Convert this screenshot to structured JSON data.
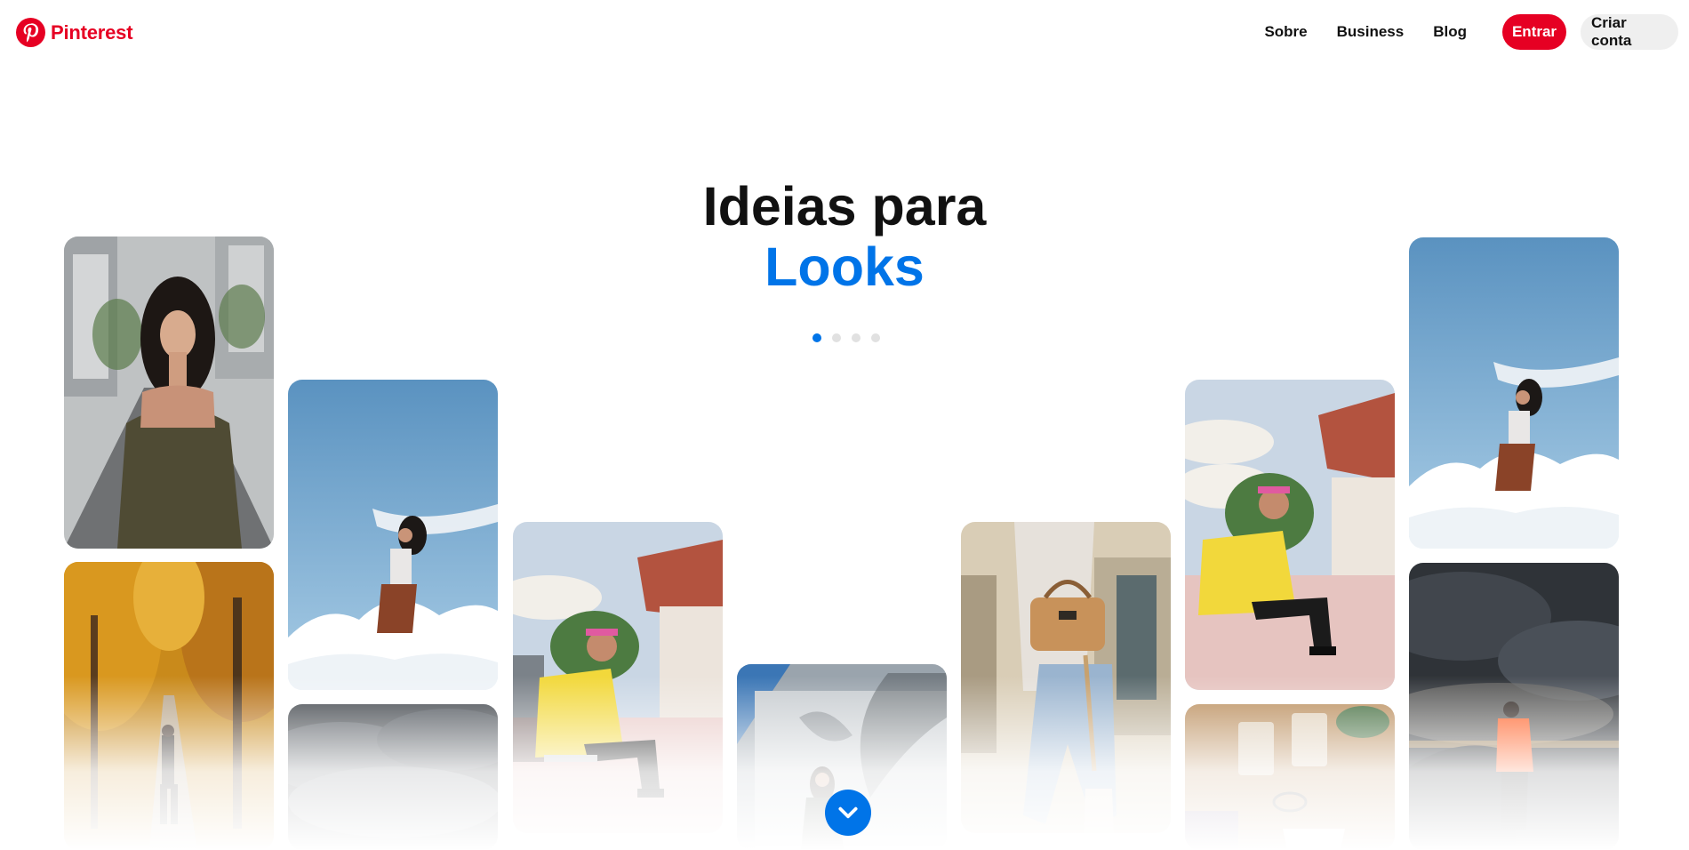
{
  "header": {
    "logo_text": "Pinterest",
    "nav": {
      "about": "Sobre",
      "business": "Business",
      "blog": "Blog"
    },
    "login_label": "Entrar",
    "signup_label": "Criar conta"
  },
  "hero": {
    "title": "Ideias para",
    "topic": "Looks",
    "topic_color": "#0074e8",
    "carousel_dots": 4,
    "active_dot": 1
  },
  "pins": [
    {
      "name": "pin-woman-street"
    },
    {
      "name": "pin-autumn-forest"
    },
    {
      "name": "pin-sky-scarf"
    },
    {
      "name": "pin-storm-clouds"
    },
    {
      "name": "pin-yellow-jacket"
    },
    {
      "name": "pin-palm-wall"
    },
    {
      "name": "pin-handbag-jeans"
    },
    {
      "name": "pin-yellow-jacket-2"
    },
    {
      "name": "pin-glasses-table"
    },
    {
      "name": "pin-sky-scarf-2"
    },
    {
      "name": "pin-orange-jacket-night"
    }
  ],
  "icons": {
    "logo": "pinterest-p-icon",
    "scroll": "chevron-down-icon"
  },
  "colors": {
    "brand_red": "#e60023",
    "accent_blue": "#0074e8"
  }
}
